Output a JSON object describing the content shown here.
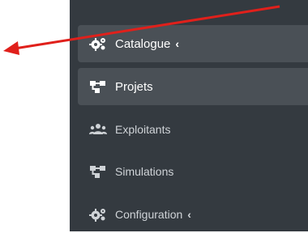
{
  "sidebar": {
    "items": [
      {
        "label": "Catalogue",
        "chevron": "‹",
        "icon": "gears-icon"
      },
      {
        "label": "Projets",
        "icon": "sitemap-icon"
      },
      {
        "label": "Exploitants",
        "icon": "users-icon"
      },
      {
        "label": "Simulations",
        "icon": "sitemap-icon"
      },
      {
        "label": "Configuration",
        "chevron": "‹",
        "icon": "gears-icon"
      }
    ]
  },
  "colors": {
    "sidebar_bg": "#343a40",
    "highlight_bg": "#4a5056",
    "annotation_arrow": "#e0201b"
  }
}
